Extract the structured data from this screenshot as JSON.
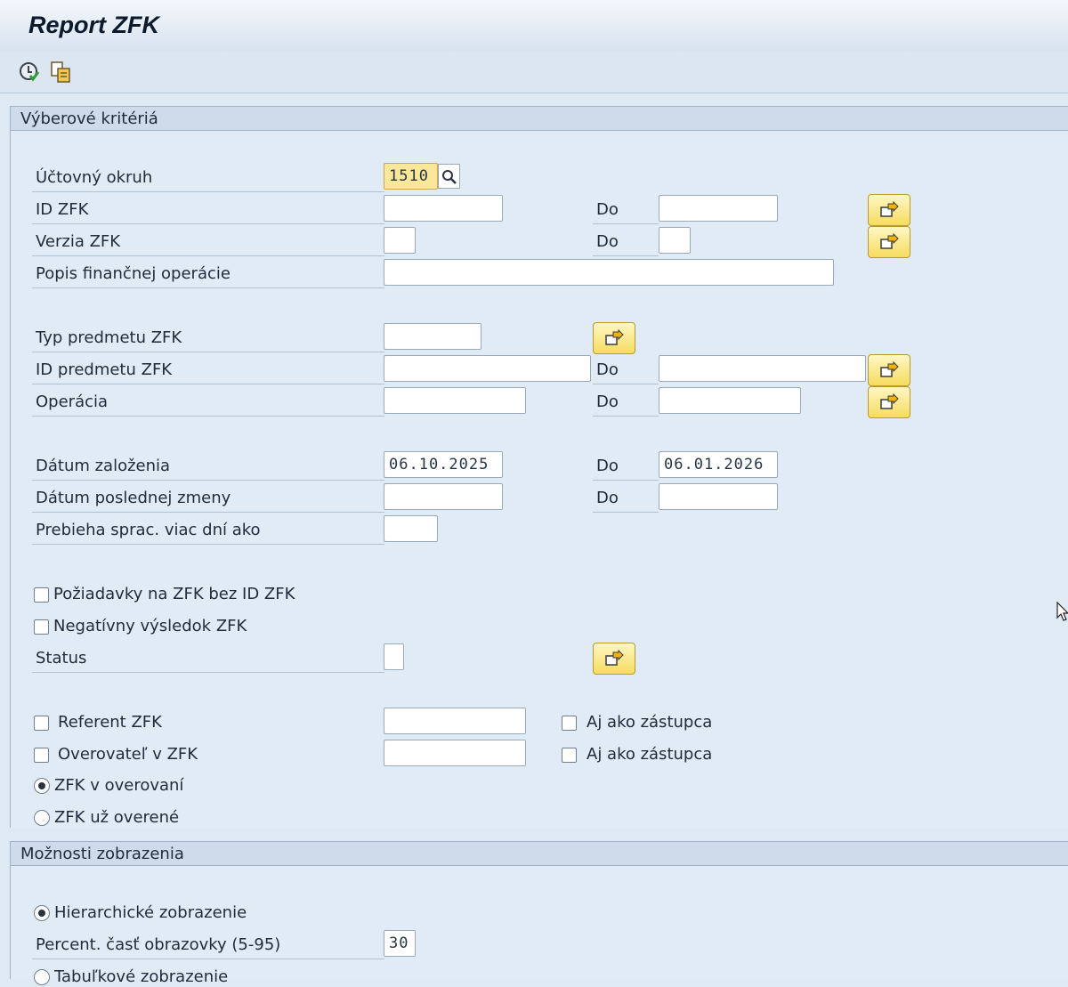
{
  "window": {
    "title": "Report ZFK"
  },
  "toolbar": {
    "execute_icon": "execute-icon",
    "variant_icon": "get-variant-icon"
  },
  "selection": {
    "header": "Výberové kritériá",
    "company_code": {
      "label": "Účtovný okruh",
      "value": "1510"
    },
    "zfk_id": {
      "label": "ID ZFK",
      "to_label": "Do",
      "from": "",
      "to": ""
    },
    "zfk_version": {
      "label": "Verzia ZFK",
      "to_label": "Do",
      "from": "",
      "to": ""
    },
    "operation_desc": {
      "label": "Popis finančnej operácie",
      "value": ""
    },
    "subject_type": {
      "label": "Typ predmetu ZFK",
      "value": ""
    },
    "subject_id": {
      "label": "ID predmetu ZFK",
      "to_label": "Do",
      "from": "",
      "to": ""
    },
    "operation": {
      "label": "Operácia",
      "to_label": "Do",
      "from": "",
      "to": ""
    },
    "created_date": {
      "label": "Dátum založenia",
      "to_label": "Do",
      "from": "06.10.2025",
      "to": "06.01.2026"
    },
    "changed_date": {
      "label": "Dátum poslednej zmeny",
      "to_label": "Do",
      "from": "",
      "to": ""
    },
    "processing_days": {
      "label": "Prebieha sprac. viac dní ako",
      "value": ""
    },
    "requests_without_id": {
      "label": "Požiadavky na ZFK bez ID ZFK",
      "checked": false
    },
    "negative_result": {
      "label": "Negatívny výsledok ZFK",
      "checked": false
    },
    "status": {
      "label": "Status",
      "value": ""
    },
    "referent": {
      "label": "Referent ZFK",
      "checked": false,
      "value": "",
      "deputy_label": "Aj ako zástupca",
      "deputy_checked": false
    },
    "verifier": {
      "label": "Overovateľ v ZFK",
      "checked": false,
      "value": "",
      "deputy_label": "Aj ako zástupca",
      "deputy_checked": false
    },
    "in_verification": {
      "label": "ZFK v overovaní",
      "selected": true
    },
    "verified": {
      "label": "ZFK už overené",
      "selected": false
    }
  },
  "display": {
    "header": "Možnosti zobrazenia",
    "hierarchical": {
      "label": "Hierarchické zobrazenie",
      "selected": true
    },
    "screen_percent": {
      "label": "Percent. časť obrazovky (5-95)",
      "value": "30"
    },
    "table": {
      "label": "Tabuľkové zobrazenie",
      "selected": false
    }
  }
}
